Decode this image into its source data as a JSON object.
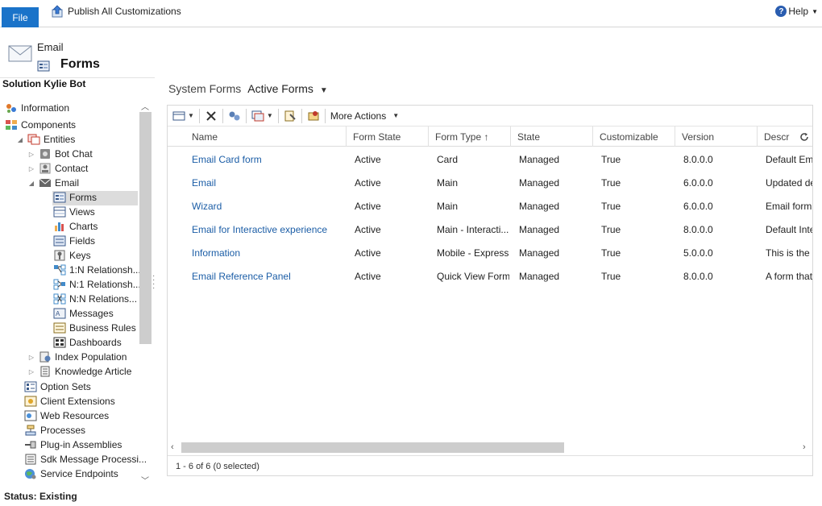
{
  "ribbon": {
    "file_label": "File",
    "publish_label": "Publish All Customizations",
    "help_label": "Help",
    "help_icon_text": "?"
  },
  "header": {
    "entity": "Email",
    "title": "Forms"
  },
  "nav": {
    "solution_label": "Solution Kylie Bot",
    "items": {
      "information": "Information",
      "components": "Components",
      "entities": "Entities",
      "bot_chat": "Bot Chat",
      "contact": "Contact",
      "email": "Email",
      "forms": "Forms",
      "views": "Views",
      "charts": "Charts",
      "fields": "Fields",
      "keys": "Keys",
      "rel_1n": "1:N Relationsh...",
      "rel_n1": "N:1 Relationsh...",
      "rel_nn": "N:N Relations...",
      "messages": "Messages",
      "business_rules": "Business Rules",
      "dashboards": "Dashboards",
      "index_population": "Index Population",
      "knowledge_article": "Knowledge Article",
      "option_sets": "Option Sets",
      "client_extensions": "Client Extensions",
      "web_resources": "Web Resources",
      "processes": "Processes",
      "plugin_assemblies": "Plug-in Assemblies",
      "sdk_message": "Sdk Message Processi...",
      "service_endpoints": "Service Endpoints"
    }
  },
  "status": "Status: Existing",
  "view": {
    "prefix": "System Forms",
    "current": "Active Forms"
  },
  "toolbar": {
    "more_actions": "More Actions"
  },
  "columns": {
    "name": "Name",
    "form_state": "Form State",
    "form_type": "Form Type ↑",
    "state": "State",
    "customizable": "Customizable",
    "version": "Version",
    "description": "Descr"
  },
  "rows": [
    {
      "name": "Email Card form",
      "form_state": "Active",
      "form_type": "Card",
      "state": "Managed",
      "customizable": "True",
      "version": "8.0.0.0",
      "description": "Default Email Card form"
    },
    {
      "name": "Email",
      "form_state": "Active",
      "form_type": "Main",
      "state": "Managed",
      "customizable": "True",
      "version": "6.0.0.0",
      "description": "Updated default"
    },
    {
      "name": "Wizard",
      "form_state": "Active",
      "form_type": "Main",
      "state": "Managed",
      "customizable": "True",
      "version": "6.0.0.0",
      "description": "Email form for"
    },
    {
      "name": "Email for Interactive experience",
      "form_state": "Active",
      "form_type": "Main - Interacti...",
      "state": "Managed",
      "customizable": "True",
      "version": "8.0.0.0",
      "description": "Default Interactive"
    },
    {
      "name": "Information",
      "form_state": "Active",
      "form_type": "Mobile - Express",
      "state": "Managed",
      "customizable": "True",
      "version": "5.0.0.0",
      "description": "This is the form"
    },
    {
      "name": "Email Reference Panel",
      "form_state": "Active",
      "form_type": "Quick View Form",
      "state": "Managed",
      "customizable": "True",
      "version": "8.0.0.0",
      "description": "A form that"
    }
  ],
  "record_count": "1 - 6 of 6 (0 selected)"
}
